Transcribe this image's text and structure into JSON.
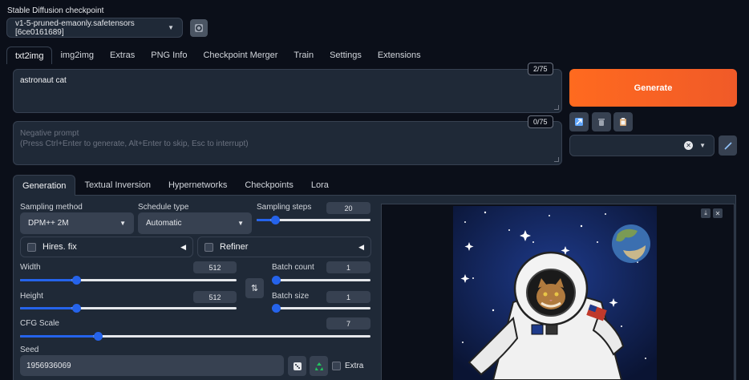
{
  "checkpoint": {
    "label": "Stable Diffusion checkpoint",
    "value": "v1-5-pruned-emaonly.safetensors [6ce0161689]"
  },
  "tabs": [
    "txt2img",
    "img2img",
    "Extras",
    "PNG Info",
    "Checkpoint Merger",
    "Train",
    "Settings",
    "Extensions"
  ],
  "prompt": {
    "value": "astronaut cat",
    "counter": "2/75"
  },
  "negative_prompt": {
    "placeholder_line1": "Negative prompt",
    "placeholder_line2": "(Press Ctrl+Enter to generate, Alt+Enter to skip, Esc to interrupt)",
    "counter": "0/75"
  },
  "generate_label": "Generate",
  "sub_tabs": [
    "Generation",
    "Textual Inversion",
    "Hypernetworks",
    "Checkpoints",
    "Lora"
  ],
  "sampling_method": {
    "label": "Sampling method",
    "value": "DPM++ 2M"
  },
  "schedule_type": {
    "label": "Schedule type",
    "value": "Automatic"
  },
  "sampling_steps": {
    "label": "Sampling steps",
    "value": "20",
    "fraction": 0.13
  },
  "hires_fix": {
    "label": "Hires. fix"
  },
  "refiner": {
    "label": "Refiner"
  },
  "width": {
    "label": "Width",
    "value": "512",
    "fraction": 0.24
  },
  "height": {
    "label": "Height",
    "value": "512",
    "fraction": 0.24
  },
  "batch_count": {
    "label": "Batch count",
    "value": "1",
    "fraction": 0.0
  },
  "batch_size": {
    "label": "Batch size",
    "value": "1",
    "fraction": 0.0
  },
  "cfg_scale": {
    "label": "CFG Scale",
    "value": "7",
    "fraction": 0.21
  },
  "seed": {
    "label": "Seed",
    "value": "1956936069"
  },
  "extra_label": "Extra",
  "colors": {
    "accent": "#ff6a1f",
    "slider": "#2563eb"
  }
}
